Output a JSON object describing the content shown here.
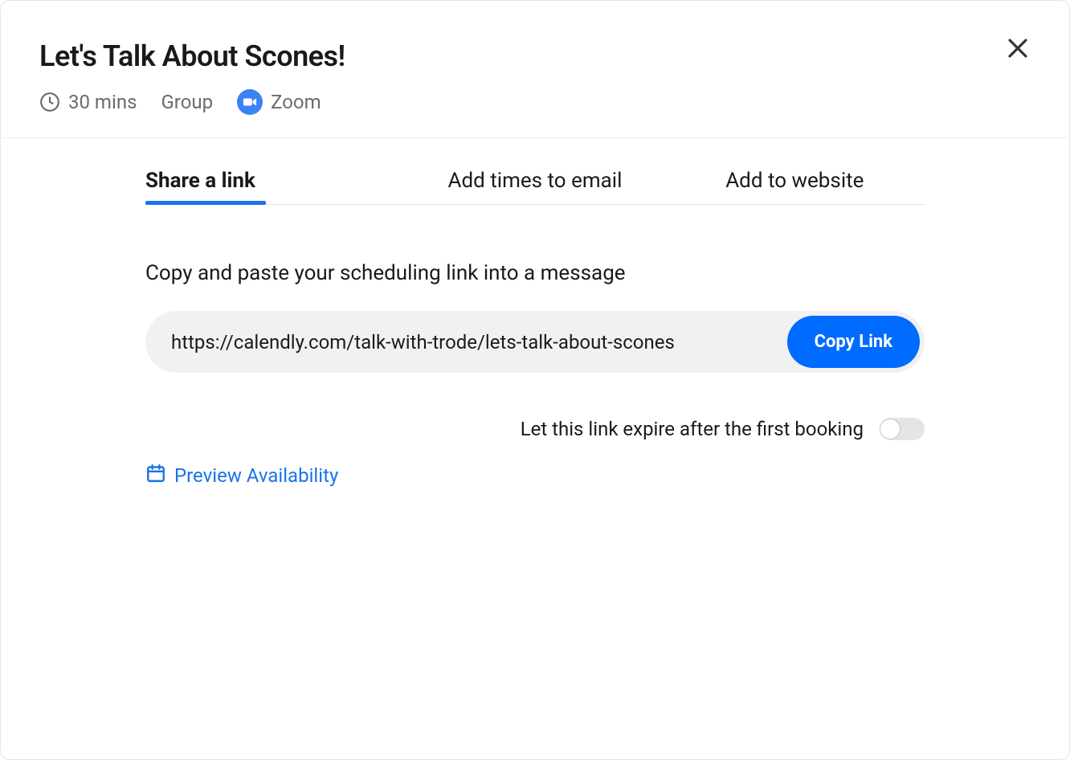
{
  "header": {
    "title": "Let's Talk About Scones!",
    "duration": "30 mins",
    "type": "Group",
    "location": "Zoom"
  },
  "tabs": {
    "share_link": "Share a link",
    "add_times": "Add times to email",
    "add_website": "Add to website"
  },
  "share": {
    "instruction": "Copy and paste your scheduling link into a message",
    "url": "https://calendly.com/talk-with-trode/lets-talk-about-scones",
    "copy_label": "Copy Link",
    "expire_label": "Let this link expire after the first booking",
    "expire_enabled": false,
    "preview_label": "Preview Availability"
  }
}
